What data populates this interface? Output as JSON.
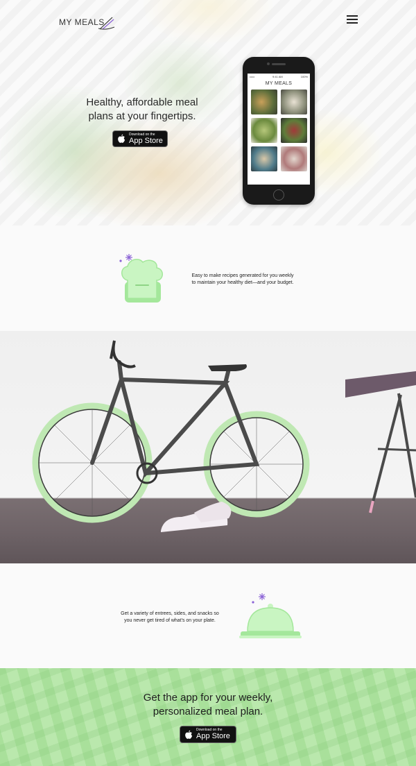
{
  "header": {
    "logo_text": "MY MEALS",
    "menu_icon": "hamburger-menu-icon"
  },
  "hero": {
    "title": "Healthy, affordable meal\nplans at your fingertips.",
    "badge_small": "Download on the",
    "badge_big": "App Store"
  },
  "phone": {
    "time": "9:41 AM",
    "carrier": "•••••",
    "battery": "100%",
    "logo_text": "MY MEALS"
  },
  "feature1": {
    "icon": "chef-hat-icon",
    "text": "Easy to make recipes generated for you weekly\nto maintain your healthy diet—and your budget."
  },
  "feature2": {
    "icon": "cloche-icon",
    "text": "Get a variety of entrees, sides, and snacks so\nyou never get tired of what's on your plate."
  },
  "cta": {
    "title": "Get the app for your weekly,\npersonalized meal plan.",
    "badge_small": "Download on the",
    "badge_big": "App Store"
  },
  "colors": {
    "accent_green": "#b8f0b0",
    "accent_purple": "#8a62d6",
    "text_dark": "#222222"
  }
}
